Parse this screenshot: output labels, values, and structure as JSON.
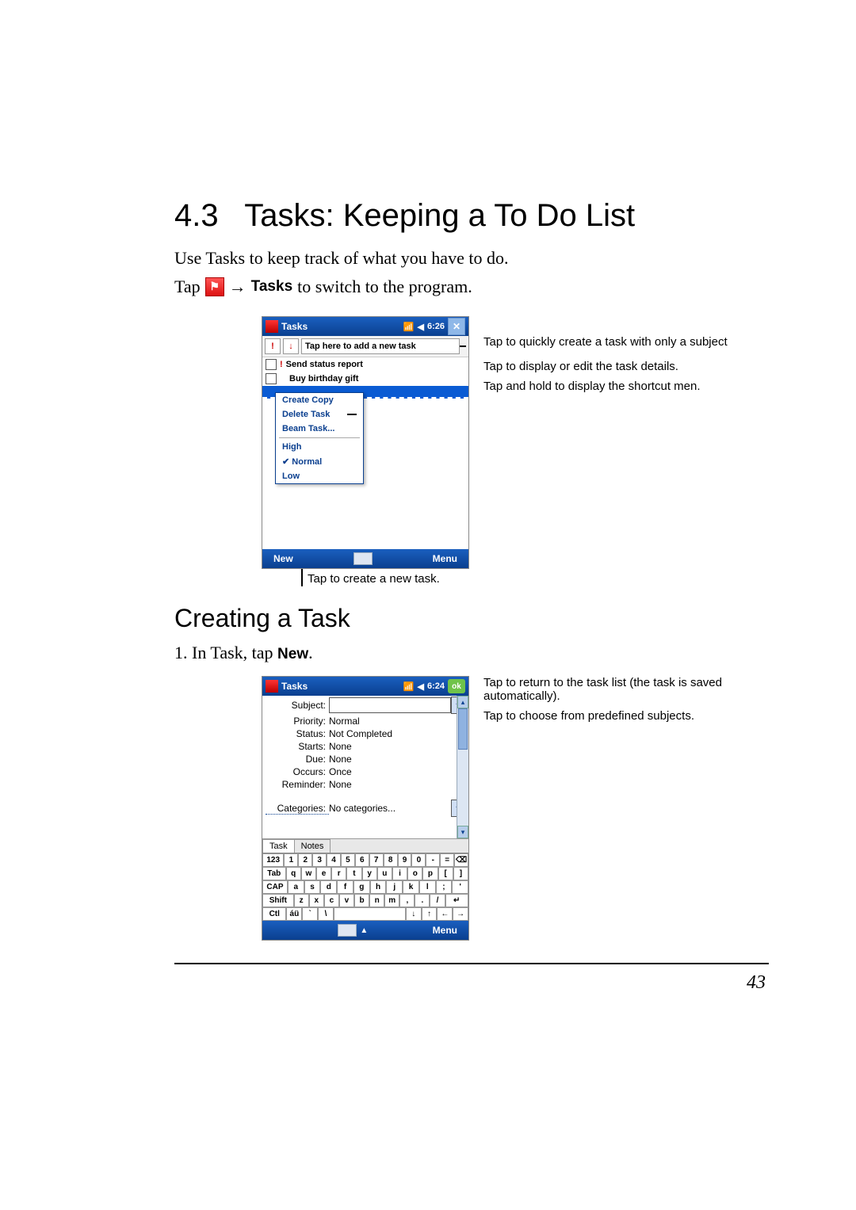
{
  "section": {
    "number": "4.3",
    "title": "Tasks: Keeping a To Do List",
    "intro": "Use Tasks to keep track of what you have to do.",
    "tap_prefix": "Tap",
    "tap_word_tasks": "Tasks",
    "tap_suffix": " to switch to the program."
  },
  "fig1": {
    "title": "Tasks",
    "time": "6:26",
    "add_placeholder": "Tap here to add a new task",
    "task1": "Send status report",
    "task2": "Buy birthday gift",
    "menu": {
      "create_copy": "Create Copy",
      "delete_task": "Delete Task",
      "beam_task": "Beam Task...",
      "high": "High",
      "normal": "Normal",
      "low": "Low"
    },
    "softkey_left": "New",
    "softkey_right": "Menu",
    "caption_below": "Tap to create a new task.",
    "callout1": "Tap to quickly create a task with only a subject",
    "callout2": "Tap to display or edit the task details.",
    "callout3": "Tap and hold to display the shortcut men."
  },
  "creating": {
    "heading": "Creating a Task",
    "step_prefix": "1.   In Task, tap ",
    "step_bold": "New",
    "step_suffix": "."
  },
  "fig2": {
    "title": "Tasks",
    "time": "6:24",
    "ok": "ok",
    "labels": {
      "subject": "Subject:",
      "priority": "Priority:",
      "status": "Status:",
      "starts": "Starts:",
      "due": "Due:",
      "occurs": "Occurs:",
      "reminder": "Reminder:",
      "categories": "Categories:"
    },
    "values": {
      "priority": "Normal",
      "status": "Not Completed",
      "starts": "None",
      "due": "None",
      "occurs": "Once",
      "reminder": "None",
      "categories": "No categories..."
    },
    "tabs": {
      "task": "Task",
      "notes": "Notes"
    },
    "keyboard": {
      "r1": [
        "123",
        "1",
        "2",
        "3",
        "4",
        "5",
        "6",
        "7",
        "8",
        "9",
        "0",
        "-",
        "=",
        "⌫"
      ],
      "r2": [
        "Tab",
        "q",
        "w",
        "e",
        "r",
        "t",
        "y",
        "u",
        "i",
        "o",
        "p",
        "[",
        "]"
      ],
      "r3": [
        "CAP",
        "a",
        "s",
        "d",
        "f",
        "g",
        "h",
        "j",
        "k",
        "l",
        ";",
        "'"
      ],
      "r4": [
        "Shift",
        "z",
        "x",
        "c",
        "v",
        "b",
        "n",
        "m",
        ",",
        ".",
        "/",
        "↵"
      ],
      "r5": [
        "Ctl",
        "áü",
        "`",
        "\\",
        " ",
        "↓",
        "↑",
        "←",
        "→"
      ]
    },
    "softkey_right": "Menu",
    "callout_ok": "Tap to return to the task list (the task is saved automatically).",
    "callout_drop": "Tap to choose from predefined subjects."
  },
  "page_number": "43"
}
